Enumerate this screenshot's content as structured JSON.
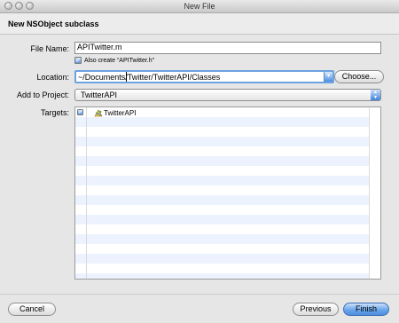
{
  "window": {
    "title": "New File"
  },
  "sheet": {
    "heading": "New NSObject subclass"
  },
  "form": {
    "file_name_label": "File Name:",
    "file_name_value": "APITwitter.m",
    "also_create_label": "Also create “APITwitter.h”",
    "also_create_checked": true,
    "location_label": "Location:",
    "location_value": "~/Documents/Twitter/TwitterAPI/Classes",
    "choose_label": "Choose...",
    "add_to_project_label": "Add to Project:",
    "add_to_project_value": "TwitterAPI",
    "targets_label": "Targets:",
    "targets": [
      {
        "name": "TwitterAPI",
        "checked": true
      }
    ]
  },
  "buttons": {
    "cancel": "Cancel",
    "previous": "Previous",
    "finish": "Finish"
  },
  "colors": {
    "accent": "#4c8ee0",
    "stripe": "#edf3fe",
    "focus_ring": "#6da2e0"
  }
}
